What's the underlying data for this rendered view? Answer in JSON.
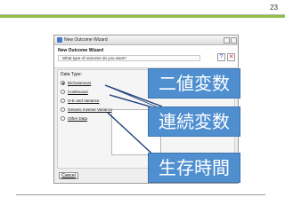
{
  "slide": {
    "page_number": "23"
  },
  "wizard": {
    "window_title": "New Outcome Wizard",
    "header_title": "New Outcome Wizard",
    "question_text": "What type of outcome do you want?",
    "help_symbol": "?",
    "close_symbol": "✕",
    "data_type_label": "Data Type:",
    "options": [
      {
        "label": "Dichotomous",
        "selected": true
      },
      {
        "label": "Continuous",
        "selected": false
      },
      {
        "label": "O-E and Variance",
        "selected": false
      },
      {
        "label": "Generic Inverse Variance",
        "selected": false
      },
      {
        "label": "Other Data",
        "selected": false
      }
    ],
    "cancel_label": "Cancel"
  },
  "callouts": [
    {
      "text": "二値変数"
    },
    {
      "text": "連続変数"
    },
    {
      "text": "生存時間"
    }
  ],
  "colors": {
    "callout_fill": "#4f8fd0",
    "header_band": "#8fbf45",
    "connector": "#1f3f7a"
  },
  "icons": [
    "app-icon",
    "help-icon",
    "close-icon",
    "radio-button"
  ]
}
